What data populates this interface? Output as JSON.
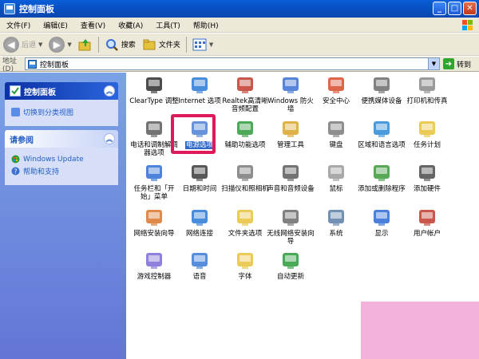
{
  "window": {
    "title": "控制面板"
  },
  "menu": [
    "文件(F)",
    "编辑(E)",
    "查看(V)",
    "收藏(A)",
    "工具(T)",
    "帮助(H)"
  ],
  "toolbar": {
    "back": "后退",
    "search": "搜索",
    "folders": "文件夹"
  },
  "address": {
    "label": "地址(D)",
    "value": "控制面板",
    "go": "转到"
  },
  "left_panel": {
    "primary": {
      "title": "控制面板",
      "link": "切换到分类视图"
    },
    "secondary": {
      "title": "请参阅",
      "links": [
        "Windows Update",
        "帮助和支持"
      ]
    }
  },
  "icons": [
    {
      "label": "ClearType 调整",
      "icon": "cleartype-icon",
      "color": "#2d2d2d"
    },
    {
      "label": "Internet 选项",
      "icon": "globe-icon",
      "color": "#2a78d6"
    },
    {
      "label": "Realtek高清晰音频配置",
      "icon": "speaker-icon",
      "color": "#c0392b"
    },
    {
      "label": "Windows 防火墙",
      "icon": "firewall-icon",
      "color": "#3b6fd1"
    },
    {
      "label": "安全中心",
      "icon": "shield-icon",
      "color": "#d94a2a"
    },
    {
      "label": "便携媒体设备",
      "icon": "media-device-icon",
      "color": "#6b6b6b"
    },
    {
      "label": "打印机和传真",
      "icon": "printer-icon",
      "color": "#8a8a8a"
    },
    {
      "label": "电话和调制解调器选项",
      "icon": "phone-icon",
      "color": "#5a5a5a"
    },
    {
      "label": "电源选项",
      "icon": "power-icon",
      "color": "#4a7fd4"
    },
    {
      "label": "辅助功能选项",
      "icon": "accessibility-icon",
      "color": "#2b9a3a"
    },
    {
      "label": "管理工具",
      "icon": "admin-tools-icon",
      "color": "#d9a32a"
    },
    {
      "label": "键盘",
      "icon": "keyboard-icon",
      "color": "#7a7a7a"
    },
    {
      "label": "区域和语言选项",
      "icon": "region-globe-icon",
      "color": "#2a8ad6"
    },
    {
      "label": "任务计划",
      "icon": "task-folder-icon",
      "color": "#e6c23a"
    },
    {
      "label": "任务栏和「开始」菜单",
      "icon": "taskbar-icon",
      "color": "#2e6ed3"
    },
    {
      "label": "日期和时间",
      "icon": "clock-icon",
      "color": "#3a3a3a"
    },
    {
      "label": "扫描仪和照相机",
      "icon": "scanner-icon",
      "color": "#7a7a7a"
    },
    {
      "label": "声音和音频设备",
      "icon": "audio-icon",
      "color": "#5a5a5a"
    },
    {
      "label": "鼠标",
      "icon": "mouse-icon",
      "color": "#9a9a9a"
    },
    {
      "label": "添加或删除程序",
      "icon": "add-remove-icon",
      "color": "#3a9a3a"
    },
    {
      "label": "添加硬件",
      "icon": "hardware-icon",
      "color": "#4a4a4a"
    },
    {
      "label": "网络安装向导",
      "icon": "home-network-icon",
      "color": "#d9762a"
    },
    {
      "label": "网络连接",
      "icon": "network-icon",
      "color": "#2a78d6"
    },
    {
      "label": "文件夹选项",
      "icon": "folder-options-icon",
      "color": "#e6c23a"
    },
    {
      "label": "无线网络安装向导",
      "icon": "wireless-icon",
      "color": "#6a6a6a"
    },
    {
      "label": "系统",
      "icon": "system-icon",
      "color": "#5a7fa6"
    },
    {
      "label": "显示",
      "icon": "display-icon",
      "color": "#2a6ad6"
    },
    {
      "label": "用户帐户",
      "icon": "users-icon",
      "color": "#c0392b"
    },
    {
      "label": "游戏控制器",
      "icon": "gamepad-icon",
      "color": "#7a6ad6"
    },
    {
      "label": "语音",
      "icon": "speech-icon",
      "color": "#3a7ad6"
    },
    {
      "label": "字体",
      "icon": "fonts-folder-icon",
      "color": "#e6c23a"
    },
    {
      "label": "自动更新",
      "icon": "windows-update-icon",
      "color": "#2a9a3a"
    }
  ]
}
